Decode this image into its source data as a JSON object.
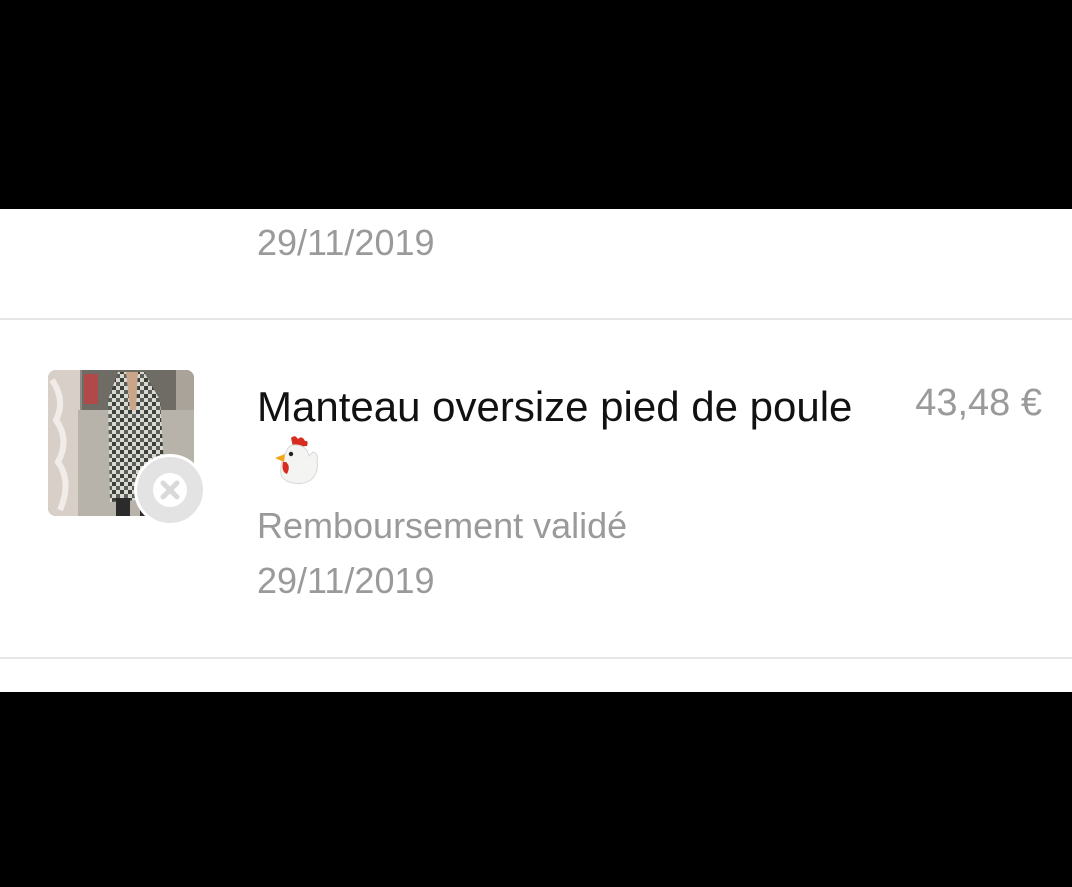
{
  "previous_item": {
    "date": "29/11/2019"
  },
  "item": {
    "thumbnail_icon": "coat-photo-thumbnail",
    "status_badge_icon": "close-icon",
    "title": "Manteau oversize pied de poule",
    "title_emoji": "chicken-emoji-icon",
    "price": "43,48 €",
    "status": "Remboursement validé",
    "date": "29/11/2019"
  },
  "colors": {
    "background": "#ffffff",
    "title_text": "#111111",
    "secondary_text": "#9a9a9a",
    "divider": "#e6e6e6",
    "badge": "#e3e3e3",
    "letterbox": "#000000"
  }
}
